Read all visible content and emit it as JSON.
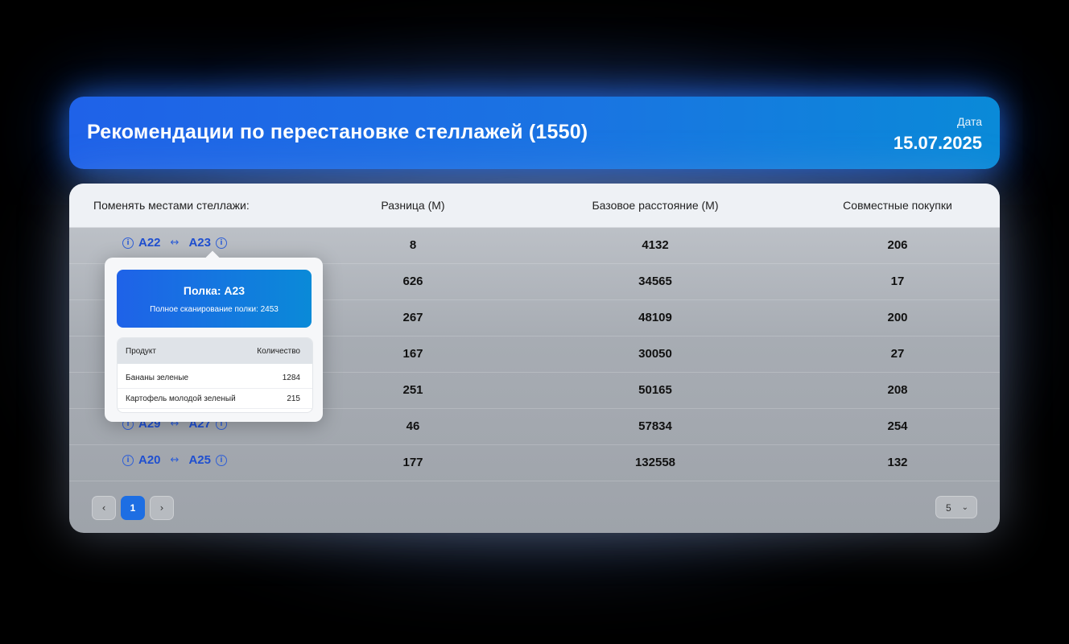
{
  "header": {
    "title": "Рекомендации по перестановке стеллажей (1550)",
    "date_label": "Дата",
    "date_value": "15.07.2025"
  },
  "table": {
    "columns": [
      "Поменять местами стеллажи:",
      "Разница (М)",
      "Базовое расстояние (М)",
      "Совместные покупки"
    ],
    "arrow": "↔",
    "rows": [
      {
        "from": "A22",
        "to": "A23",
        "diff": "8",
        "base": "4132",
        "joint": "206"
      },
      {
        "from": "",
        "to": "",
        "diff": "626",
        "base": "34565",
        "joint": "17"
      },
      {
        "from": "",
        "to": "",
        "diff": "267",
        "base": "48109",
        "joint": "200"
      },
      {
        "from": "",
        "to": "",
        "diff": "167",
        "base": "30050",
        "joint": "27"
      },
      {
        "from": "",
        "to": "",
        "diff": "251",
        "base": "50165",
        "joint": "208"
      },
      {
        "from": "A29",
        "to": "A27",
        "diff": "46",
        "base": "57834",
        "joint": "254"
      },
      {
        "from": "A20",
        "to": "A25",
        "diff": "177",
        "base": "132558",
        "joint": "132"
      }
    ]
  },
  "popover": {
    "title": "Полка: A23",
    "subtitle": "Полное сканирование полки: 2453",
    "col_product": "Продукт",
    "col_qty": "Количество",
    "items": [
      {
        "product": "Бананы зеленые",
        "qty": "1284"
      },
      {
        "product": "Картофель молодой зеленый",
        "qty": "215"
      }
    ]
  },
  "pagination": {
    "prev": "‹",
    "current": "1",
    "next": "›",
    "page_size": "5"
  },
  "colors": {
    "accent": "#1f62e8",
    "accent_end": "#0a8ad8",
    "shelf_text": "#1f4fd0"
  }
}
